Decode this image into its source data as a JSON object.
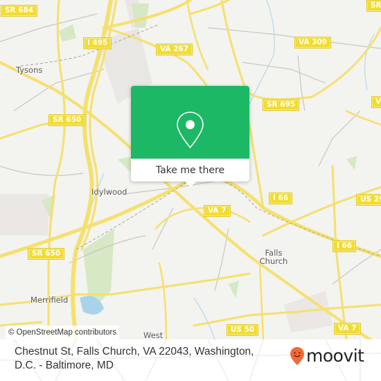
{
  "map": {
    "shields": [
      {
        "label": "SR 684"
      },
      {
        "label": "I 495"
      },
      {
        "label": "VA 267"
      },
      {
        "label": "VA 309"
      },
      {
        "label": "SR 650"
      },
      {
        "label": "SR 695"
      },
      {
        "label": "I 66"
      },
      {
        "label": "VA 7"
      },
      {
        "label": "SR 650"
      },
      {
        "label": "I 66"
      },
      {
        "label": "US 29"
      },
      {
        "label": "US 50"
      },
      {
        "label": "VA 7"
      },
      {
        "label": "SR"
      },
      {
        "label": "V"
      }
    ],
    "places": [
      {
        "label": "Tysons"
      },
      {
        "label": "Idylwood"
      },
      {
        "label": "Falls"
      },
      {
        "label": "Church"
      },
      {
        "label": "Merrifield"
      },
      {
        "label": "West"
      }
    ],
    "attribution": "© OpenStreetMap contributors"
  },
  "popup": {
    "icon": "map-pin-icon",
    "button_label": "Take me there",
    "accent_color": "#1db865"
  },
  "footer": {
    "address_line1": "Chestnut St, Falls Church, VA 22043, Washington,",
    "address_line2": "D.C. - Baltimore, MD",
    "brand": "moovit",
    "brand_color": "#f26a36"
  }
}
